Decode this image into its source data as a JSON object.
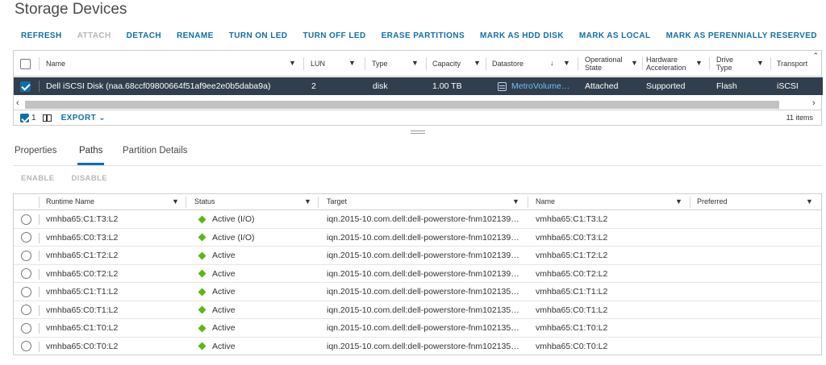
{
  "page": {
    "title": "Storage Devices"
  },
  "toolbar": [
    {
      "label": "REFRESH",
      "enabled": true
    },
    {
      "label": "ATTACH",
      "enabled": false
    },
    {
      "label": "DETACH",
      "enabled": true
    },
    {
      "label": "RENAME",
      "enabled": true
    },
    {
      "label": "TURN ON LED",
      "enabled": true
    },
    {
      "label": "TURN OFF LED",
      "enabled": true
    },
    {
      "label": "ERASE PARTITIONS",
      "enabled": true
    },
    {
      "label": "MARK AS HDD DISK",
      "enabled": true
    },
    {
      "label": "MARK AS LOCAL",
      "enabled": true
    },
    {
      "label": "MARK AS PERENNIALLY RESERVED",
      "enabled": true
    }
  ],
  "devices": {
    "columns": {
      "name": "Name",
      "lun": "LUN",
      "type": "Type",
      "capacity": "Capacity",
      "datastore": "Datastore",
      "op_state_1": "Operational",
      "op_state_2": "State",
      "hw_accel_1": "Hardware",
      "hw_accel_2": "Acceleration",
      "drive_type_1": "Drive",
      "drive_type_2": "Type",
      "transport": "Transport"
    },
    "rows": [
      {
        "name": "Dell iSCSI Disk (naa.68ccf09800664f51af9ee2e0b5daba9a)",
        "lun": "2",
        "type": "disk",
        "capacity": "1.00 TB",
        "datastore": "MetroVolume…",
        "op_state": "Attached",
        "hw_accel": "Supported",
        "drive_type": "Flash",
        "transport": "iSCSI",
        "selected": true
      }
    ],
    "footer": {
      "selected_count": "1",
      "export_label": "EXPORT",
      "items_label": "11 items"
    }
  },
  "tabs": [
    {
      "label": "Properties",
      "active": false
    },
    {
      "label": "Paths",
      "active": true
    },
    {
      "label": "Partition Details",
      "active": false
    }
  ],
  "paths_toolbar": [
    {
      "label": "ENABLE",
      "enabled": false
    },
    {
      "label": "DISABLE",
      "enabled": false
    }
  ],
  "paths": {
    "columns": {
      "runtime_name": "Runtime Name",
      "status": "Status",
      "target": "Target",
      "name": "Name",
      "preferred": "Preferred"
    },
    "rows": [
      {
        "runtime_name": "vmhba65:C1:T3:L2",
        "status": "Active (I/O)",
        "target": "iqn.2015-10.com.dell:dell-powerstore-fnm102139…",
        "name": "vmhba65:C1:T3:L2",
        "preferred": ""
      },
      {
        "runtime_name": "vmhba65:C0:T3:L2",
        "status": "Active (I/O)",
        "target": "iqn.2015-10.com.dell:dell-powerstore-fnm102139…",
        "name": "vmhba65:C0:T3:L2",
        "preferred": ""
      },
      {
        "runtime_name": "vmhba65:C1:T2:L2",
        "status": "Active",
        "target": "iqn.2015-10.com.dell:dell-powerstore-fnm102139…",
        "name": "vmhba65:C1:T2:L2",
        "preferred": ""
      },
      {
        "runtime_name": "vmhba65:C0:T2:L2",
        "status": "Active",
        "target": "iqn.2015-10.com.dell:dell-powerstore-fnm102139…",
        "name": "vmhba65:C0:T2:L2",
        "preferred": ""
      },
      {
        "runtime_name": "vmhba65:C1:T1:L2",
        "status": "Active",
        "target": "iqn.2015-10.com.dell:dell-powerstore-fnm102135…",
        "name": "vmhba65:C1:T1:L2",
        "preferred": ""
      },
      {
        "runtime_name": "vmhba65:C0:T1:L2",
        "status": "Active",
        "target": "iqn.2015-10.com.dell:dell-powerstore-fnm102135…",
        "name": "vmhba65:C0:T1:L2",
        "preferred": ""
      },
      {
        "runtime_name": "vmhba65:C1:T0:L2",
        "status": "Active",
        "target": "iqn.2015-10.com.dell:dell-powerstore-fnm102135…",
        "name": "vmhba65:C1:T0:L2",
        "preferred": ""
      },
      {
        "runtime_name": "vmhba65:C0:T0:L2",
        "status": "Active",
        "target": "iqn.2015-10.com.dell:dell-powerstore-fnm102135…",
        "name": "vmhba65:C0:T0:L2",
        "preferred": ""
      }
    ]
  },
  "colors": {
    "accent": "#0f6fab",
    "selected_row_bg": "#313e4e",
    "status_active": "#60b515",
    "disabled": "#b7b7b7"
  }
}
